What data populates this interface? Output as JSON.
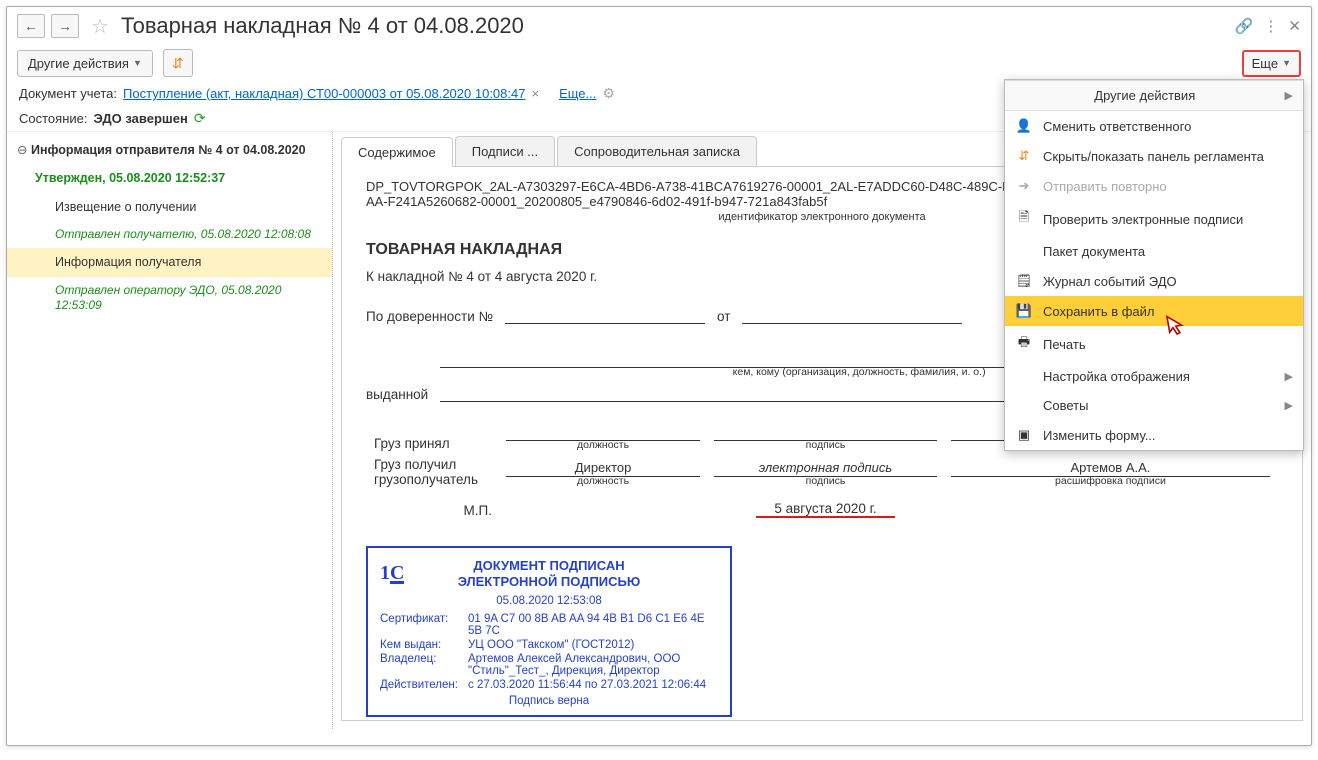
{
  "title": "Товарная накладная № 4 от 04.08.2020",
  "toolbar": {
    "other_actions": "Другие действия",
    "more": "Еще"
  },
  "info": {
    "doc_label": "Документ учета:",
    "doc_link": "Поступление (акт, накладная) СТ00-000003 от 05.08.2020 10:08:47",
    "more_link": "Еще...",
    "state_label": "Состояние:",
    "state_value": "ЭДО завершен"
  },
  "tree": {
    "root": "Информация отправителя № 4 от 04.08.2020",
    "approved": "Утвержден, 05.08.2020 12:52:37",
    "receipt_notice": "Извещение о получении",
    "receipt_status": "Отправлен получателю, 05.08.2020 12:08:08",
    "recipient_info": "Информация получателя",
    "recipient_status": "Отправлен оператору ЭДО, 05.08.2020 12:53:09"
  },
  "tabs": {
    "content": "Содержимое",
    "signatures": "Подписи ...",
    "note": "Сопроводительная записка"
  },
  "doc": {
    "id_line1": "DP_TOVTORGPOK_2AL-A7303297-E6CA-4BD6-A738-41BCA7619276-00001_2AL-E7ADDC60-D48C-489C-BB",
    "id_line2": "AA-F241A5260682-00001_20200805_e4790846-6d02-491f-b947-721a843fab5f",
    "id_caption": "идентификатор электронного документа",
    "title": "ТОВАРНАЯ НАКЛАДНАЯ",
    "subtitle": "К накладной № 4 от 4 августа 2020 г.",
    "proxy_label": "По доверенности №",
    "from_label": "от",
    "issued_label": "выданной",
    "issued_caption": "кем, кому (организация, должность, фамилия, и. о.)",
    "cargo_accepted": "Груз принял",
    "cargo_received": "Груз получил грузополучатель",
    "col_position": "должность",
    "col_signature": "подпись",
    "col_decipher": "расшифровка подписи",
    "position_value": "Директор",
    "signature_value": "электронная подпись",
    "decipher_value": "Артемов А.А.",
    "mp": "М.П.",
    "mp_date": "5 августа 2020 г."
  },
  "stamp": {
    "head1": "ДОКУМЕНТ ПОДПИСАН",
    "head2": "ЭЛЕКТРОННОЙ ПОДПИСЬЮ",
    "date": "05.08.2020 12:53:08",
    "cert_label": "Сертификат:",
    "cert_value": "01 9A C7 00 8B AB AA 94 4B B1 D6 C1 E6 4E 5B 7C",
    "issued_label": "Кем выдан:",
    "issued_value": "УЦ ООО \"Такском\" (ГОСТ2012)",
    "owner_label": "Владелец:",
    "owner_value": "Артемов Алексей Александрович, ООО \"Стиль\"_Тест_, Дирекция, Директор",
    "valid_label": "Действителен:",
    "valid_value": "с 27.03.2020 11:56:44 по 27.03.2021 12:06:44",
    "foot": "Подпись верна"
  },
  "menu": {
    "other_actions": "Другие действия",
    "change_responsible": "Сменить ответственного",
    "toggle_panel": "Скрыть/показать панель регламента",
    "resend": "Отправить повторно",
    "verify": "Проверить электронные подписи",
    "package": "Пакет документа",
    "event_log": "Журнал событий ЭДО",
    "save_file": "Сохранить в файл",
    "print": "Печать",
    "display_settings": "Настройка отображения",
    "tips": "Советы",
    "change_form": "Изменить форму..."
  }
}
